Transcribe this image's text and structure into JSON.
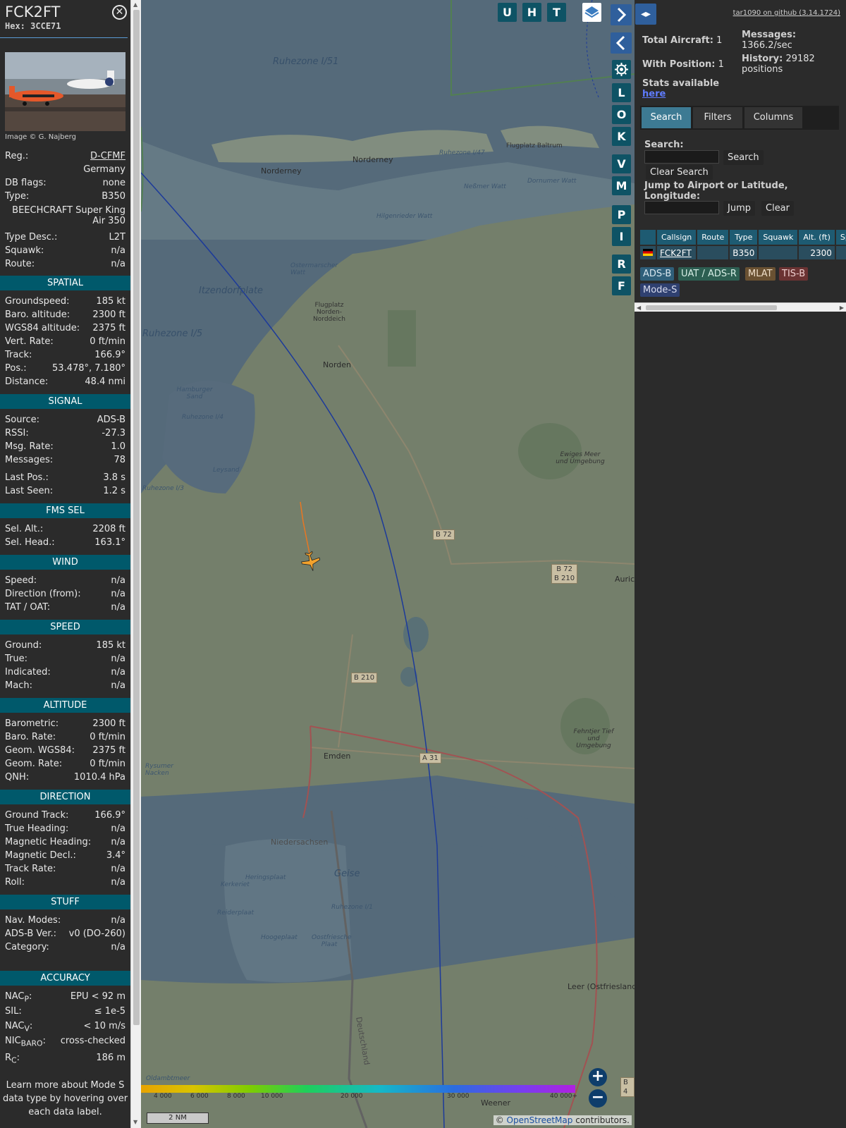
{
  "aircraft": {
    "callsign": "FCK2FT",
    "hex_label": "Hex:",
    "hex": "3CCE71",
    "image_credit": "Image © G. Najberg",
    "fields": [
      {
        "k": "Reg.:",
        "v": "D-CFMF"
      },
      {
        "k": "",
        "v": "Germany"
      },
      {
        "k": "DB flags:",
        "v": "none"
      },
      {
        "k": "Type:",
        "v": "B350"
      },
      {
        "k": "",
        "v": "BEECHCRAFT Super King Air 350"
      },
      {
        "k": "Type Desc.:",
        "v": "L2T"
      },
      {
        "k": "Squawk:",
        "v": "n/a"
      },
      {
        "k": "Route:",
        "v": "n/a"
      }
    ]
  },
  "sections": {
    "spatial": {
      "title": "SPATIAL",
      "rows": [
        {
          "k": "Groundspeed:",
          "v": "185 kt"
        },
        {
          "k": "Baro. altitude:",
          "v": "2300 ft"
        },
        {
          "k": "WGS84 altitude:",
          "v": "2375 ft"
        },
        {
          "k": "Vert. Rate:",
          "v": "0 ft/min"
        },
        {
          "k": "Track:",
          "v": "166.9°"
        },
        {
          "k": "Pos.:",
          "v": "53.478°, 7.180°"
        },
        {
          "k": "Distance:",
          "v": "48.4 nmi"
        }
      ]
    },
    "signal": {
      "title": "SIGNAL",
      "rows": [
        {
          "k": "Source:",
          "v": "ADS-B"
        },
        {
          "k": "RSSI:",
          "v": "-27.3"
        },
        {
          "k": "Msg. Rate:",
          "v": "1.0"
        },
        {
          "k": "Messages:",
          "v": "78"
        },
        {
          "k": "Last Pos.:",
          "v": "3.8 s"
        },
        {
          "k": "Last Seen:",
          "v": "1.2 s"
        }
      ]
    },
    "fms": {
      "title": "FMS SEL",
      "rows": [
        {
          "k": "Sel. Alt.:",
          "v": "2208 ft"
        },
        {
          "k": "Sel. Head.:",
          "v": "163.1°"
        }
      ]
    },
    "wind": {
      "title": "WIND",
      "rows": [
        {
          "k": "Speed:",
          "v": "n/a"
        },
        {
          "k": "Direction (from):",
          "v": "n/a"
        },
        {
          "k": "TAT / OAT:",
          "v": "n/a"
        }
      ]
    },
    "speed": {
      "title": "SPEED",
      "rows": [
        {
          "k": "Ground:",
          "v": "185 kt"
        },
        {
          "k": "True:",
          "v": "n/a"
        },
        {
          "k": "Indicated:",
          "v": "n/a"
        },
        {
          "k": "Mach:",
          "v": "n/a"
        }
      ]
    },
    "altitude": {
      "title": "ALTITUDE",
      "rows": [
        {
          "k": "Barometric:",
          "v": "2300 ft"
        },
        {
          "k": "Baro. Rate:",
          "v": "0 ft/min"
        },
        {
          "k": "Geom. WGS84:",
          "v": "2375 ft"
        },
        {
          "k": "Geom. Rate:",
          "v": "0 ft/min"
        },
        {
          "k": "QNH:",
          "v": "1010.4 hPa"
        }
      ]
    },
    "direction": {
      "title": "DIRECTION",
      "rows": [
        {
          "k": "Ground Track:",
          "v": "166.9°"
        },
        {
          "k": "True Heading:",
          "v": "n/a"
        },
        {
          "k": "Magnetic Heading:",
          "v": "n/a"
        },
        {
          "k": "Magnetic Decl.:",
          "v": "3.4°"
        },
        {
          "k": "Track Rate:",
          "v": "n/a"
        },
        {
          "k": "Roll:",
          "v": "n/a"
        }
      ]
    },
    "stuff": {
      "title": "STUFF",
      "rows": [
        {
          "k": "Nav. Modes:",
          "v": "n/a"
        },
        {
          "k": "ADS-B Ver.:",
          "v": "v0 (DO-260)"
        },
        {
          "k": "Category:",
          "v": "n/a"
        }
      ]
    },
    "accuracy": {
      "title": "ACCURACY",
      "rows": [
        {
          "k": "NAC",
          "sub": "P",
          "v": "EPU < 92 m"
        },
        {
          "k": "SIL:",
          "sub": "",
          "v": "≤ 1e-5"
        },
        {
          "k": "NAC",
          "sub": "V",
          "v": "< 10 m/s"
        },
        {
          "k": "NIC",
          "sub": "BARO",
          "v": "cross-checked"
        },
        {
          "k": "R",
          "sub": "C",
          "v": "186 m"
        }
      ]
    },
    "note": "Learn more about Mode S data type by hovering over each data label."
  },
  "map": {
    "top_buttons": [
      "U",
      "H",
      "T"
    ],
    "side_buttons": [
      "L",
      "O",
      "K",
      "V",
      "M",
      "P",
      "I",
      "R",
      "F"
    ],
    "labels": {
      "ruhezone_i51": "Ruhezone I/51",
      "ruhezone_i5": "Ruhezone I/5",
      "ruhezone_i4": "Ruhezone I/4",
      "ruhezone_i1": "Ruhezone I/1",
      "norderney1": "Norderney",
      "norderney2": "Norderney",
      "norden": "Norden",
      "emden": "Emden",
      "itzendorfplate": "Itzendorfplate",
      "leysand": "Leysand",
      "geise": "Geise",
      "leer": "Leer (Ostfriesland)",
      "weener": "Weener",
      "niedersachsen": "Niedersachsen",
      "deutschland": "Deutschland",
      "aurich": "Auric",
      "ewiges_meer": "Ewiges Meer und Umgebung",
      "fehntjer": "Fehntjer Tief und Umgebung",
      "ostermarscher": "Ostermarscher Watt",
      "hilgenrieder": "Hilgenrieder Watt",
      "hamburger_sand": "Hamburger Sand",
      "flugplatz_norden": "Flugplatz Norden-Norddeich",
      "dornumer": "Dornumer Watt",
      "nessmer": "Neßmer Watt",
      "oldambtmeer": "Oldambtmeer",
      "rysumer": "Rysumer Nacken",
      "kerkeriet": "Kerkeriet",
      "heringsplaat": "Heringsplaat",
      "reiderplaat": "Reiderplaat",
      "hoogeplaat": "Hoogeplaat",
      "oostfriesche": "Oostfriesche Plaat",
      "baltrum": "Flugplatz Baltrum",
      "ruhezone_i47": "Ruhezone I/47",
      "ruhezone_i3": "Ruhezone I/3"
    },
    "roads": {
      "b72a": "B 72",
      "b72b": "B 72\nB 210",
      "b210": "B 210",
      "a31": "A 31",
      "b4": "B 4"
    },
    "legend_ticks": [
      "4 000",
      "6 000",
      "8 000",
      "10 000",
      "20 000",
      "30 000",
      "40 000+"
    ],
    "scale": "2 NM",
    "attribution_prefix": "© ",
    "attribution_link": "OpenStreetMap",
    "attribution_suffix": " contributors."
  },
  "panel": {
    "github": "tar1090 on github (3.14.1724)",
    "total_aircraft_label": "Total Aircraft:",
    "total_aircraft": "1",
    "with_position_label": "With Position:",
    "with_position": "1",
    "messages_label": "Messages:",
    "messages": "1366.2/sec",
    "history_label": "History:",
    "history": "29182 positions",
    "stats_label": "Stats available",
    "stats_link": "here",
    "tabs": [
      "Search",
      "Filters",
      "Columns"
    ],
    "search_label": "Search:",
    "search_button": "Search",
    "clear_search_button": "Clear Search",
    "jump_label": "Jump to Airport or Latitude, Longitude:",
    "jump_button": "Jump",
    "clear_button": "Clear",
    "columns": [
      "",
      "Callsign",
      "Route",
      "Type",
      "Squawk",
      "Alt. (ft)",
      "Spd."
    ],
    "row": {
      "callsign": "FCK2FT",
      "route": "",
      "type": "B350",
      "squawk": "",
      "alt": "2300",
      "spd": ""
    },
    "sources": [
      "ADS-B",
      "UAT / ADS-R",
      "MLAT",
      "TIS-B",
      "Mode-S"
    ]
  },
  "colors": {
    "section_bg": "#00596b",
    "map_button": "#0e5365",
    "track_color": "#e87722",
    "aircraft_color": "#f2a22c"
  }
}
